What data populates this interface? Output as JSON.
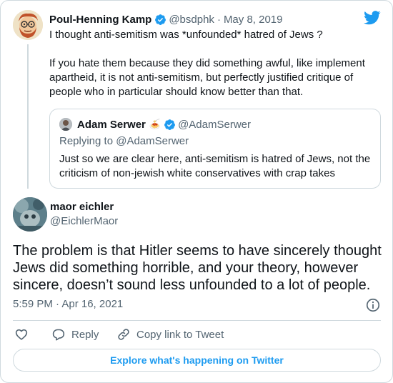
{
  "colors": {
    "brand_blue": "#1d9bf0",
    "text_primary": "#0f1419",
    "text_secondary": "#536471",
    "border": "#cfd9de"
  },
  "icons": {
    "brand": "twitter-bird-icon",
    "verified": "verified-badge-icon",
    "info": "info-icon",
    "like": "heart-icon",
    "reply": "speech-bubble-icon",
    "copy_link": "link-icon"
  },
  "parent_tweet": {
    "author_name": "Poul-Henning Kamp",
    "handle": "@bsdphk",
    "separator": "·",
    "date": "May 8, 2019",
    "text_paragraphs": [
      "I thought anti-semitism was *unfounded* hatred of Jews ?",
      "If you hate them because they did something awful, like implement apartheid, it is not anti-semitism, but perfectly justified critique of people who in particular should know better than that."
    ]
  },
  "quoted_tweet": {
    "author_name": "Adam Serwer",
    "emoji": "🍝",
    "handle": "@AdamSerwer",
    "replying_to": "Replying to @AdamSerwer",
    "text": "Just so we are clear here, anti-semitism is hatred of Jews, not the criticism of non-jewish white conservatives with crap takes"
  },
  "main_tweet": {
    "author_name": "maor eichler",
    "handle": "@EichlerMaor",
    "text": "The problem is that Hitler seems to have sincerely thought Jews did something horrible, and your theory, however sincere, doesn’t sound less unfounded to a lot of people.",
    "timestamp": "5:59 PM · Apr 16, 2021"
  },
  "actions": {
    "reply_label": "Reply",
    "copy_link_label": "Copy link to Tweet"
  },
  "explore_button": {
    "label": "Explore what's happening on Twitter"
  }
}
